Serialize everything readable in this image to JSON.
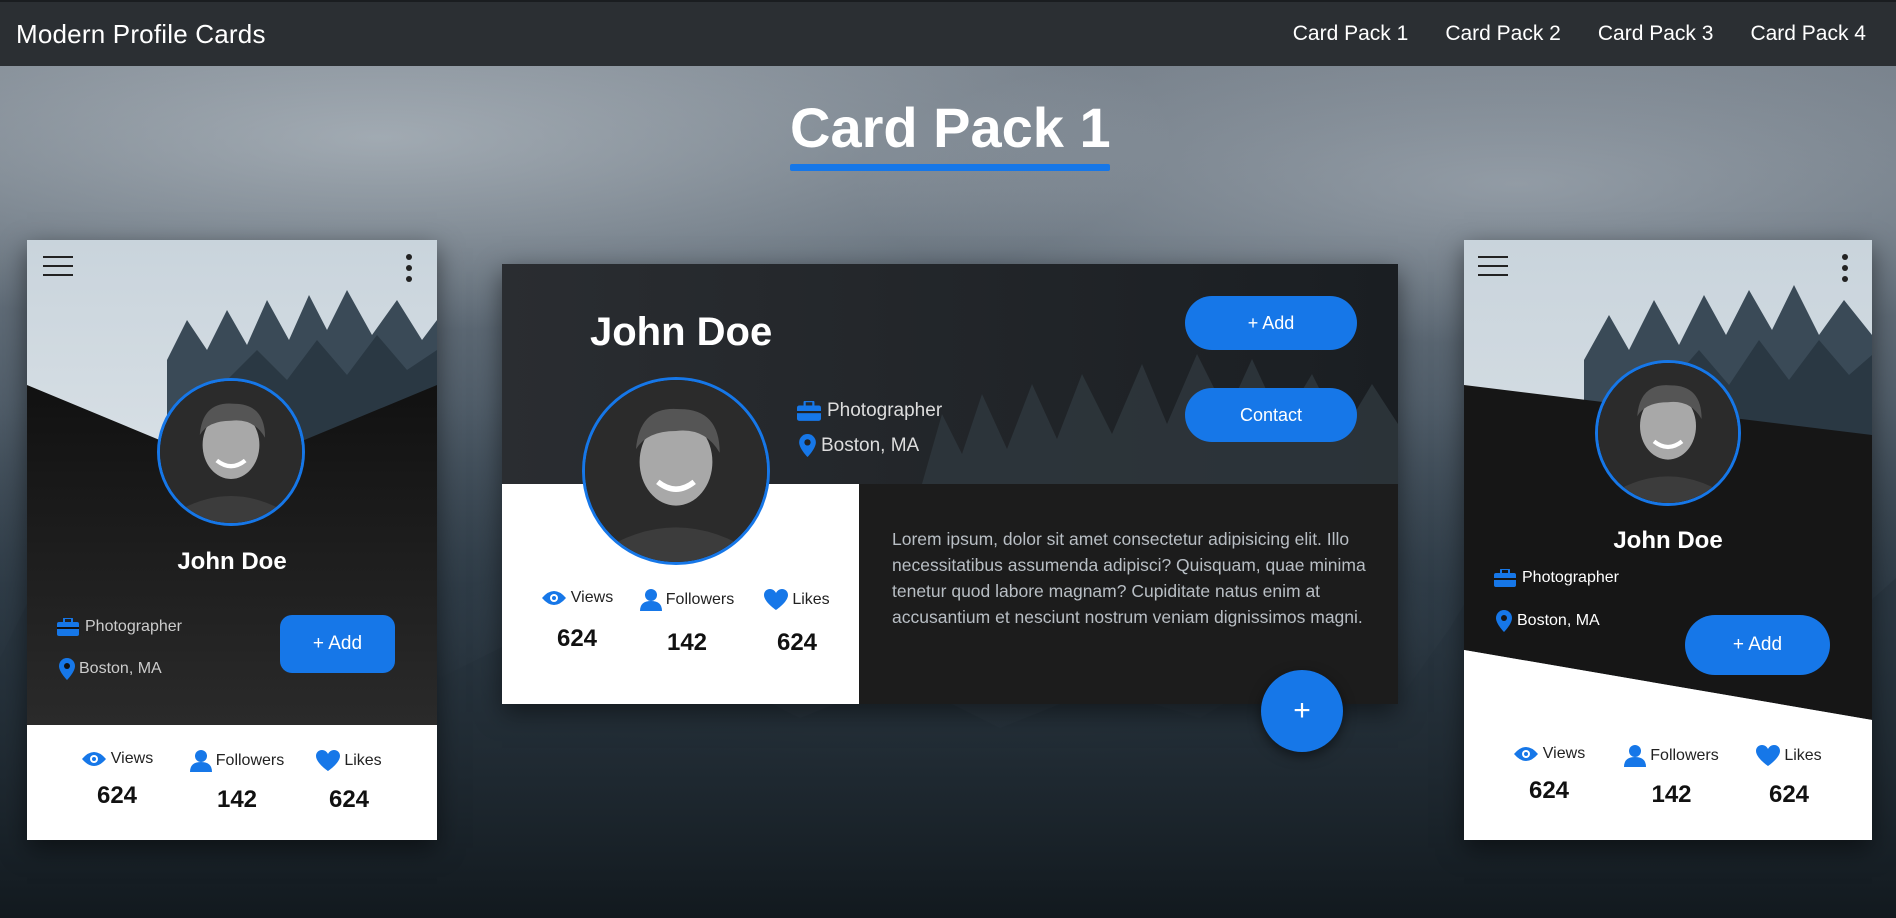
{
  "navbar": {
    "brand": "Modern Profile Cards",
    "links": [
      "Card Pack 1",
      "Card Pack 2",
      "Card Pack 3",
      "Card Pack 4"
    ]
  },
  "page": {
    "title": "Card Pack 1"
  },
  "colors": {
    "accent": "#1677e8",
    "navbar": "#2b2f33",
    "card_dark": "#1c1c1c"
  },
  "profile": {
    "name": "John Doe",
    "job": "Photographer",
    "location": "Boston, MA",
    "add_label": "+ Add",
    "contact_label": "Contact",
    "fab_label": "+",
    "bio": "Lorem ipsum, dolor sit amet consectetur adipisicing elit. Illo necessitatibus assumenda adipisci? Quisquam, quae minima tenetur quod labore magnam? Cupiditate natus enim at accusantium et nesciunt nostrum veniam dignissimos magni."
  },
  "stats": {
    "views_label": "Views",
    "followers_label": "Followers",
    "likes_label": "Likes",
    "views": "624",
    "followers": "142",
    "likes": "624"
  },
  "icons": {
    "menu": "hamburger-icon",
    "more": "kebab-icon",
    "job": "briefcase-icon",
    "location": "map-pin-icon",
    "views": "eye-icon",
    "followers": "user-icon",
    "likes": "heart-icon"
  }
}
